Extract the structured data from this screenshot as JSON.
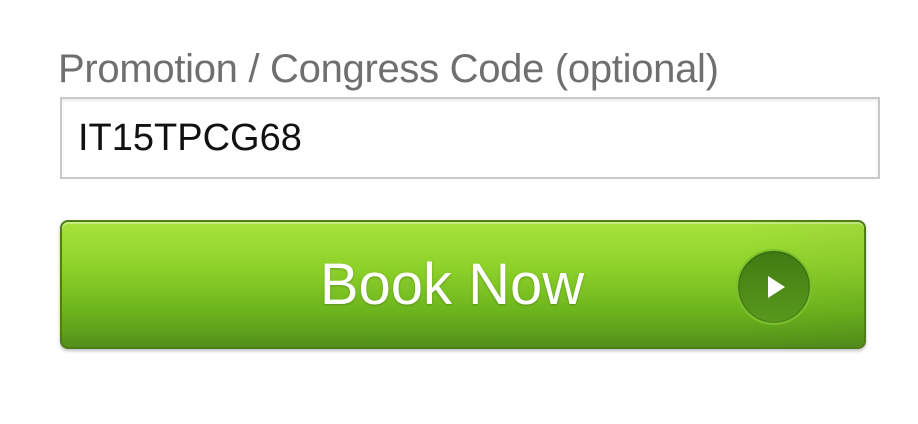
{
  "promo": {
    "label": "Promotion / Congress Code (optional)",
    "value": "IT15TPCG68"
  },
  "book_button": {
    "label": "Book Now",
    "icon": "play-circle-icon"
  },
  "colors": {
    "label_text": "#6f6f6f",
    "input_border": "#c9c9c9",
    "button_green_top": "#a6e23c",
    "button_green_bottom": "#52901a",
    "icon_circle": "#4e8c17"
  }
}
